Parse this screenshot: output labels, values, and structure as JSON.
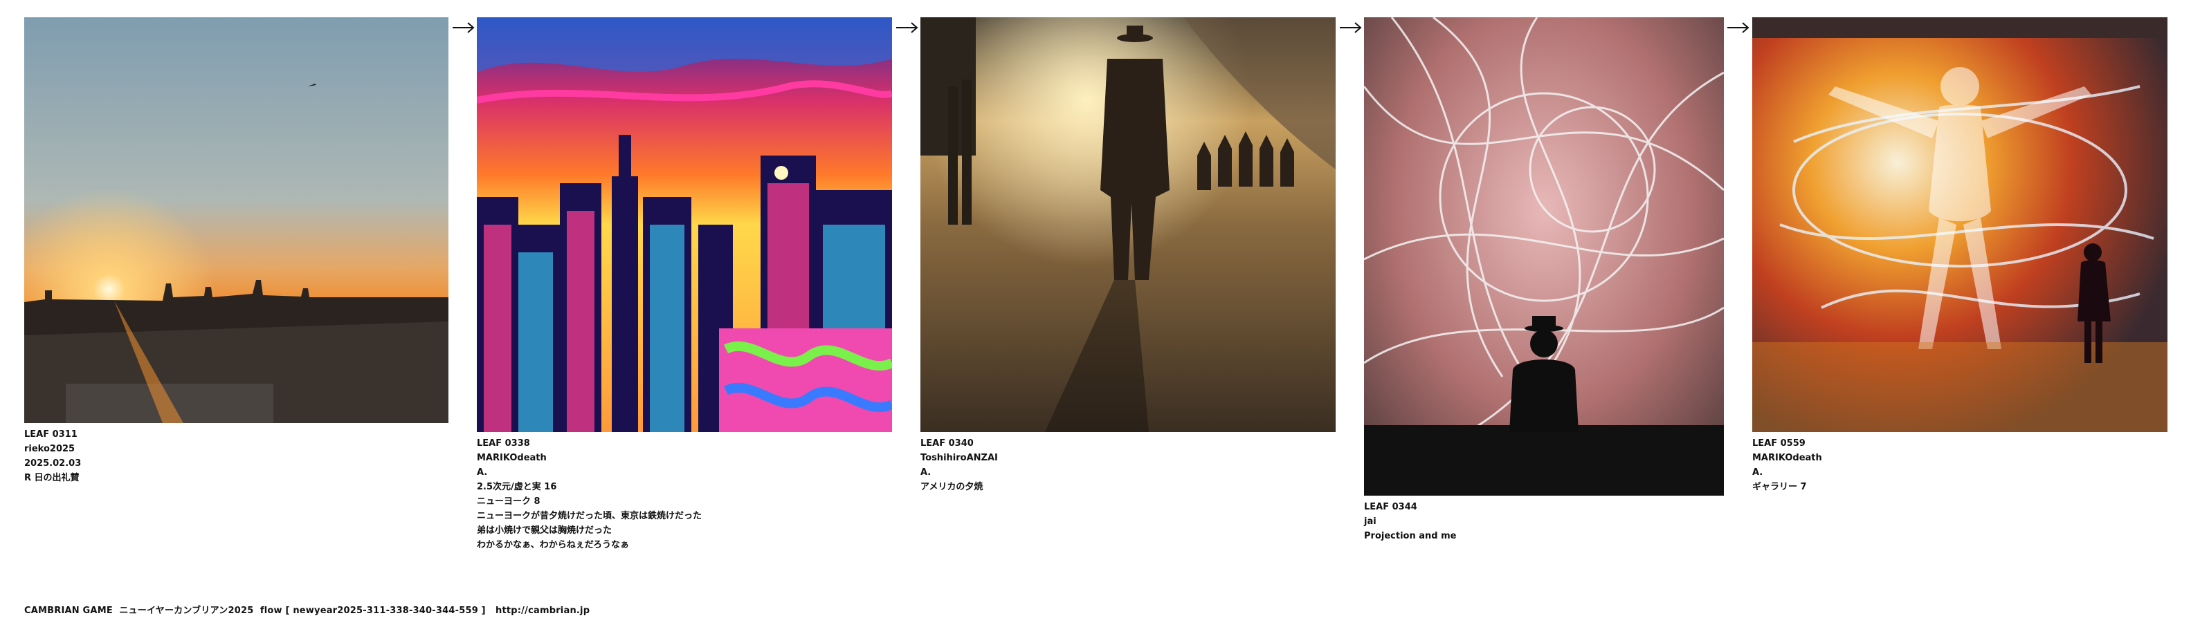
{
  "leaves": [
    {
      "id": "LEAF 0311",
      "author": "rieko2025",
      "lines": [
        "2025.02.03",
        "R 日の出礼賛"
      ]
    },
    {
      "id": "LEAF 0338",
      "author": "MARIKOdeath",
      "lines": [
        "A.",
        "2.5次元/虚と実 16",
        "ニューヨーク 8",
        "ニューヨークが昔夕焼けだった頃、東京は鉄焼けだった",
        "弟は小焼けで親父は胸焼けだった",
        "わかるかなぁ、わからねぇだろうなぁ"
      ]
    },
    {
      "id": "LEAF 0340",
      "author": "ToshihiroANZAI",
      "lines": [
        "A.",
        "アメリカの夕焼"
      ]
    },
    {
      "id": "LEAF 0344",
      "author": "jai",
      "lines": [
        "Projection and me"
      ]
    },
    {
      "id": "LEAF 0559",
      "author": "MARIKOdeath",
      "lines": [
        "A.",
        "ギャラリー 7"
      ]
    }
  ],
  "footer": {
    "text": "CAMBRIAN GAME  ニューイヤーカンブリアン2025  flow [ newyear2025-311-338-340-344-559 ]   ",
    "link": "http://cambrian.jp"
  },
  "icons": {
    "connector": "right-arrow-icon"
  }
}
